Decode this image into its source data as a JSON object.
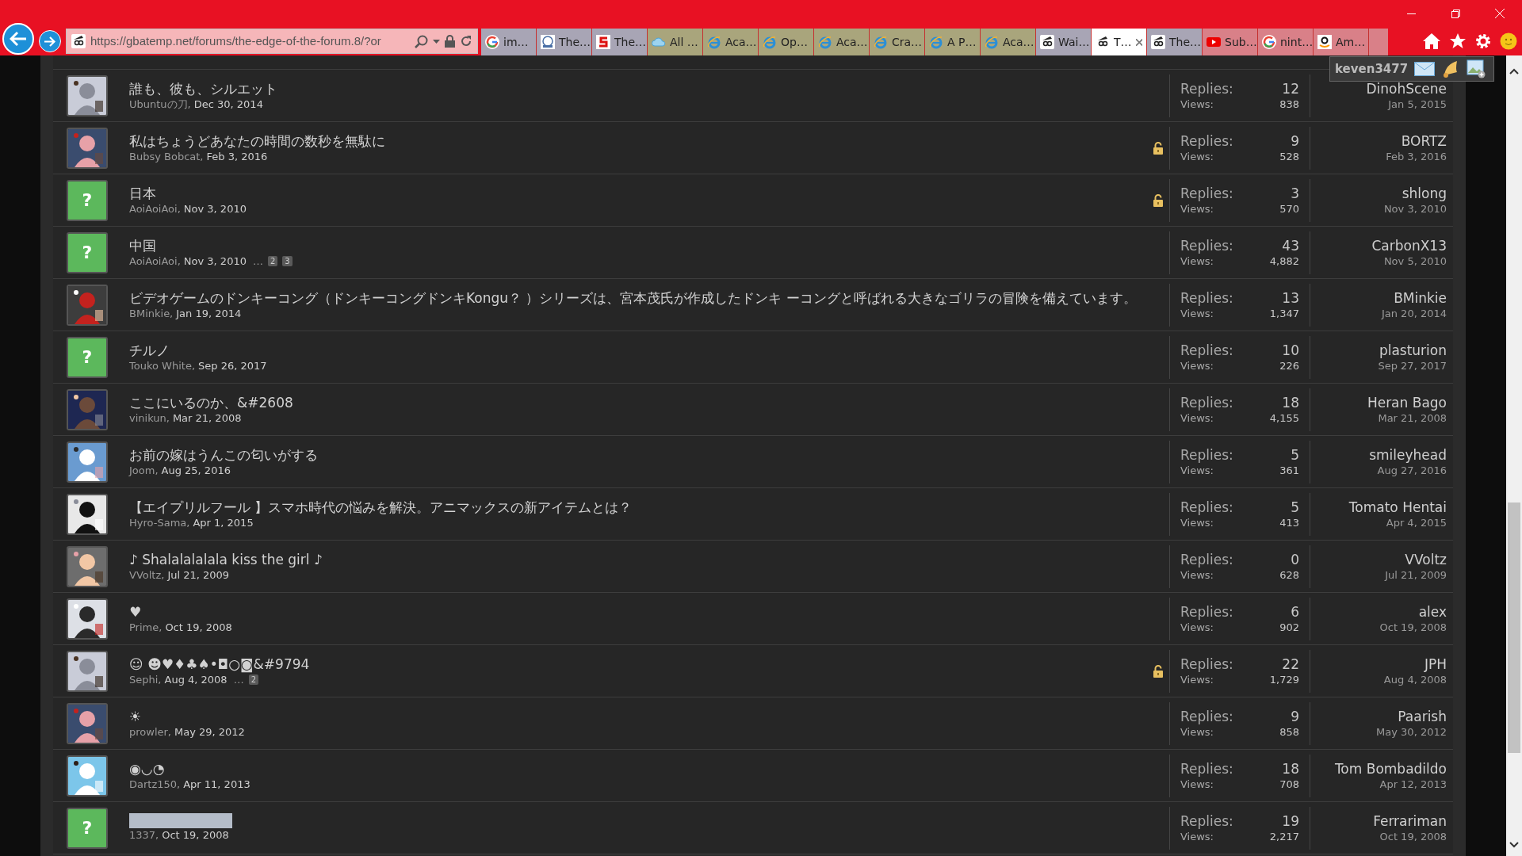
{
  "browser": {
    "url": "https://gbatemp.net/forums/the-edge-of-the-forum.8/?or",
    "tabs": [
      {
        "label": "im…",
        "kind": "google",
        "color": "#a8a5b5",
        "selected": false
      },
      {
        "label": "The…",
        "kind": "site",
        "color": "#a8a5b5",
        "selected": false
      },
      {
        "label": "The…",
        "kind": "s-logo",
        "color": "#a8a5b5",
        "selected": false
      },
      {
        "label": "All …",
        "kind": "cloud",
        "color": "#a9a57c",
        "selected": false
      },
      {
        "label": "Aca…",
        "kind": "ie",
        "color": "#a9a57c",
        "selected": false
      },
      {
        "label": "Op…",
        "kind": "ie",
        "color": "#a9a57c",
        "selected": false
      },
      {
        "label": "Aca…",
        "kind": "ie",
        "color": "#a9a57c",
        "selected": false
      },
      {
        "label": "Cra…",
        "kind": "ie",
        "color": "#a9a57c",
        "selected": false
      },
      {
        "label": "A P…",
        "kind": "ie",
        "color": "#a9a57c",
        "selected": false
      },
      {
        "label": "Aca…",
        "kind": "ie",
        "color": "#a9a57c",
        "selected": false
      },
      {
        "label": "Wai…",
        "kind": "gbatemp",
        "color": "#a8a5b5",
        "selected": false
      },
      {
        "label": "T…",
        "kind": "gbatemp",
        "selected": true
      },
      {
        "label": "The…",
        "kind": "gbatemp",
        "color": "#a8a5b5",
        "selected": false
      },
      {
        "label": "Sub…",
        "kind": "youtube",
        "color": "#d98088",
        "selected": false
      },
      {
        "label": "nint…",
        "kind": "google",
        "color": "#d98088",
        "selected": false
      },
      {
        "label": "Am…",
        "kind": "amazon",
        "color": "#d98088",
        "selected": false
      }
    ],
    "new_tab": {
      "color": "#d98088"
    }
  },
  "user_menu": {
    "username": "keven3477"
  },
  "threads": [
    {
      "kind": "picture",
      "title": "誰も、彼も、シルエット",
      "author": "Ubuntuの刀,",
      "date": "Dec 30, 2014",
      "locked": false,
      "replies_label": "Replies:",
      "replies": "12",
      "views_label": "Views:",
      "views": "838",
      "last_poster": "DinohScene",
      "last_date": "Jan 5, 2015"
    },
    {
      "kind": "picture",
      "title": "私はちょうどあなたの時間の数秒を無駄に",
      "author": "Bubsy Bobcat,",
      "date": "Feb 3, 2016",
      "locked": true,
      "replies_label": "Replies:",
      "replies": "9",
      "views_label": "Views:",
      "views": "528",
      "last_poster": "BORTZ",
      "last_date": "Feb 3, 2016"
    },
    {
      "kind": "default",
      "avatar_mark": "?",
      "title": "日本",
      "author": "AoiAoiAoi,",
      "date": "Nov 3, 2010",
      "locked": true,
      "replies_label": "Replies:",
      "replies": "3",
      "views_label": "Views:",
      "views": "570",
      "last_poster": "shlong",
      "last_date": "Nov 3, 2010"
    },
    {
      "kind": "default",
      "avatar_mark": "?",
      "title": "中国",
      "author": "AoiAoiAoi,",
      "date": "Nov 3, 2010",
      "pages_gap": "…",
      "pages": [
        "2",
        "3"
      ],
      "locked": false,
      "replies_label": "Replies:",
      "replies": "43",
      "views_label": "Views:",
      "views": "4,882",
      "last_poster": "CarbonX13",
      "last_date": "Nov 5, 2010"
    },
    {
      "kind": "picture",
      "title": "ビデオゲームのドンキーコング（ドンキーコングドンキKongu？ ）シリーズは、宮本茂氏が作成したドンキ ーコングと呼ばれる大きなゴリラの冒険を備えています。",
      "author": "BMinkie,",
      "date": "Jan 19, 2014",
      "locked": false,
      "replies_label": "Replies:",
      "replies": "13",
      "views_label": "Views:",
      "views": "1,347",
      "last_poster": "BMinkie",
      "last_date": "Jan 20, 2014"
    },
    {
      "kind": "default",
      "avatar_mark": "?",
      "title": "チルノ",
      "author": "Touko White,",
      "date": "Sep 26, 2017",
      "locked": false,
      "replies_label": "Replies:",
      "replies": "10",
      "views_label": "Views:",
      "views": "226",
      "last_poster": "plasturion",
      "last_date": "Sep 27, 2017"
    },
    {
      "kind": "picture",
      "title": "ここにいるのか、&#2608",
      "author": "vinikun,",
      "date": "Mar 21, 2008",
      "locked": false,
      "replies_label": "Replies:",
      "replies": "18",
      "views_label": "Views:",
      "views": "4,155",
      "last_poster": "Heran Bago",
      "last_date": "Mar 21, 2008"
    },
    {
      "kind": "picture",
      "title": "お前の嫁はうんこの匂いがする",
      "author": "Joom,",
      "date": "Aug 25, 2016",
      "locked": false,
      "replies_label": "Replies:",
      "replies": "5",
      "views_label": "Views:",
      "views": "361",
      "last_poster": "smileyhead",
      "last_date": "Aug 27, 2016"
    },
    {
      "kind": "picture",
      "title": "【エイプリルフール 】スマホ時代の悩みを解決。アニマックスの新アイテムとは？",
      "author": "Hyro-Sama,",
      "date": "Apr 1, 2015",
      "locked": false,
      "replies_label": "Replies:",
      "replies": "5",
      "views_label": "Views:",
      "views": "413",
      "last_poster": "Tomato Hentai",
      "last_date": "Apr 4, 2015"
    },
    {
      "kind": "picture",
      "title": "♪ Shalalalalala kiss the girl ♪",
      "author": "VVoltz,",
      "date": "Jul 21, 2009",
      "locked": false,
      "replies_label": "Replies:",
      "replies": "0",
      "views_label": "Views:",
      "views": "628",
      "last_poster": "VVoltz",
      "last_date": "Jul 21, 2009"
    },
    {
      "kind": "picture",
      "title": "♥",
      "author": "Prime,",
      "date": "Oct 19, 2008",
      "locked": false,
      "replies_label": "Replies:",
      "replies": "6",
      "views_label": "Views:",
      "views": "902",
      "last_poster": "alex",
      "last_date": "Oct 19, 2008"
    },
    {
      "kind": "picture",
      "title": "☺ ☻♥♦♣♠•◘○◙&#9794",
      "author": "Sephi,",
      "date": "Aug 4, 2008",
      "pages_gap": "…",
      "pages": [
        "2"
      ],
      "locked": true,
      "replies_label": "Replies:",
      "replies": "22",
      "views_label": "Views:",
      "views": "1,729",
      "last_poster": "JPH",
      "last_date": "Aug 4, 2008"
    },
    {
      "kind": "picture",
      "title": "☀",
      "author": "prowler,",
      "date": "May 29, 2012",
      "locked": false,
      "replies_label": "Replies:",
      "replies": "9",
      "views_label": "Views:",
      "views": "858",
      "last_poster": "Paarish",
      "last_date": "May 30, 2012"
    },
    {
      "kind": "picture",
      "title": "◉◡◔",
      "author": "Dartz150,",
      "date": "Apr 11, 2013",
      "locked": false,
      "replies_label": "Replies:",
      "replies": "18",
      "views_label": "Views:",
      "views": "708",
      "last_poster": "Tom Bombadildo",
      "last_date": "Apr 12, 2013"
    },
    {
      "kind": "default",
      "avatar_mark": "?",
      "title_redacted": true,
      "author": "1337,",
      "date": "Oct 19, 2008",
      "locked": false,
      "replies_label": "Replies:",
      "replies": "19",
      "views_label": "Views:",
      "views": "2,217",
      "last_poster": "Ferrariman",
      "last_date": "Oct 19, 2008"
    }
  ]
}
